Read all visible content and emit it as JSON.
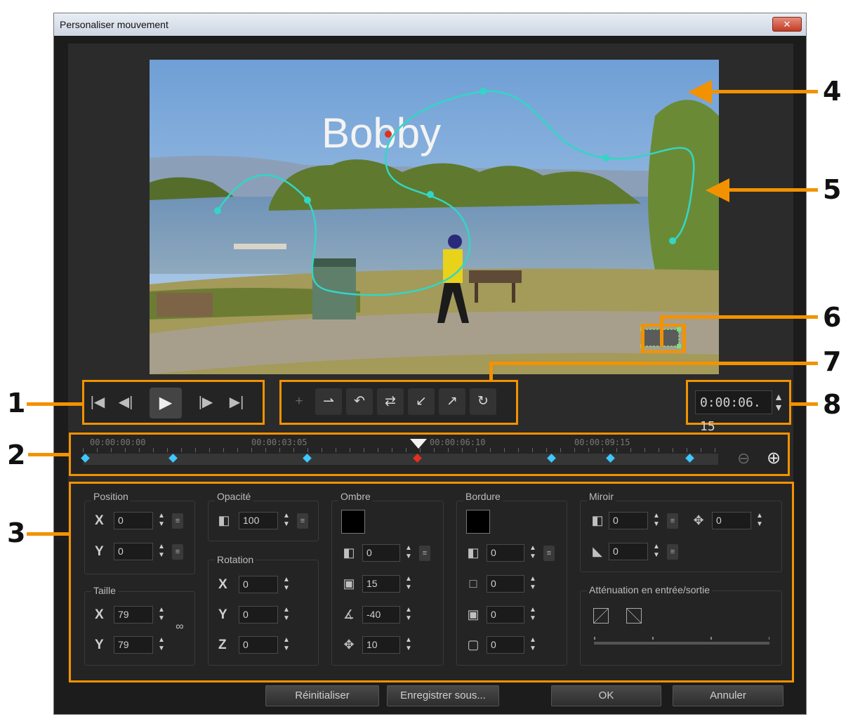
{
  "window": {
    "title": "Personaliser mouvement",
    "close_label": "✕"
  },
  "preview": {
    "overlay_text": "Bobby"
  },
  "callouts": [
    "1",
    "2",
    "3",
    "4",
    "5",
    "6",
    "7",
    "8"
  ],
  "playback": {
    "buttons": [
      {
        "name": "home",
        "glyph": "|◀"
      },
      {
        "name": "prev-frame",
        "glyph": "◀|"
      },
      {
        "name": "play",
        "glyph": "▶"
      },
      {
        "name": "next-frame",
        "glyph": "|▶"
      },
      {
        "name": "end",
        "glyph": "▶|"
      }
    ]
  },
  "toolbar": {
    "buttons": [
      {
        "name": "add-keyframe",
        "glyph": "+"
      },
      {
        "name": "add-node",
        "glyph": "⇀"
      },
      {
        "name": "curve-node",
        "glyph": "↶"
      },
      {
        "name": "reverse-path",
        "glyph": "⇄"
      },
      {
        "name": "node-left",
        "glyph": "↙"
      },
      {
        "name": "node-right",
        "glyph": "↗"
      },
      {
        "name": "rotate-node",
        "glyph": "↻"
      }
    ]
  },
  "timecode": {
    "value": "0:00:06. 15"
  },
  "timeline": {
    "labels": [
      "00:00:00:00",
      "00:00:03:05",
      "00:00:06:10",
      "00:00:09:15"
    ],
    "zoom_out": "⊖",
    "zoom_in": "⊕"
  },
  "properties": {
    "position": {
      "label": "Position",
      "x": "0",
      "y": "0"
    },
    "size": {
      "label": "Taille",
      "x": "79",
      "y": "79"
    },
    "opacity": {
      "label": "Opacité",
      "value": "100"
    },
    "rotation": {
      "label": "Rotation",
      "x": "0",
      "y": "0",
      "z": "0"
    },
    "shadow": {
      "label": "Ombre",
      "opacity": "0",
      "size": "15",
      "angle": "-40",
      "distance": "10"
    },
    "border": {
      "label": "Bordure",
      "opacity": "0",
      "width": "0",
      "blur": "0",
      "radius": "0"
    },
    "mirror": {
      "label": "Miroir",
      "opacity": "0",
      "distance": "0",
      "fade": "0"
    },
    "fade": {
      "label": "Atténuation en entrée/sortie"
    }
  },
  "footer": {
    "reset": "Réinitialiser",
    "save_as": "Enregistrer sous...",
    "ok": "OK",
    "cancel": "Annuler"
  },
  "colors": {
    "accent": "#f39200",
    "path": "#33d6c4",
    "keyframe": "#3fc7ff"
  }
}
